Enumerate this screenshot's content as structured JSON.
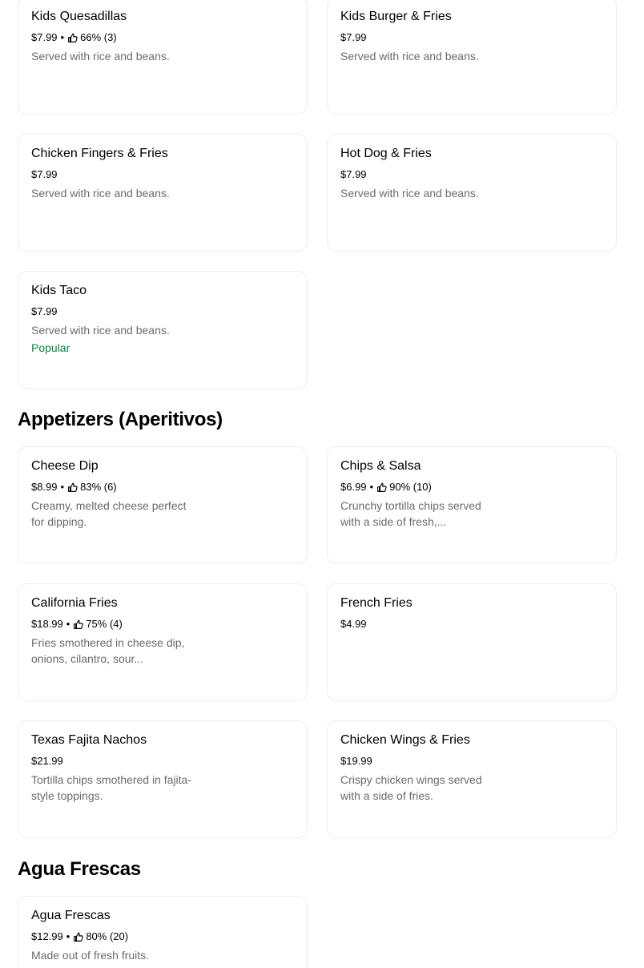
{
  "sections": [
    {
      "title": "",
      "items": [
        {
          "name": "Kids Quesadillas",
          "price": "$7.99",
          "rating": "66% (3)",
          "description": "Served with rice and beans.",
          "badge": ""
        },
        {
          "name": "Kids Burger & Fries",
          "price": "$7.99",
          "rating": "",
          "description": "Served with rice and beans.",
          "badge": ""
        },
        {
          "name": "Chicken Fingers & Fries",
          "price": "$7.99",
          "rating": "",
          "description": "Served with rice and beans.",
          "badge": ""
        },
        {
          "name": "Hot Dog & Fries",
          "price": "$7.99",
          "rating": "",
          "description": "Served with rice and beans.",
          "badge": ""
        },
        {
          "name": "Kids Taco",
          "price": "$7.99",
          "rating": "",
          "description": "Served with rice and beans.",
          "badge": "Popular"
        }
      ]
    },
    {
      "title": "Appetizers (Aperitivos)",
      "items": [
        {
          "name": "Cheese Dip",
          "price": "$8.99",
          "rating": "83% (6)",
          "description": "Creamy, melted cheese perfect for dipping.",
          "badge": ""
        },
        {
          "name": "Chips & Salsa",
          "price": "$6.99",
          "rating": "90% (10)",
          "description": "Crunchy tortilla chips served with a side of fresh,...",
          "badge": ""
        },
        {
          "name": "California Fries",
          "price": "$18.99",
          "rating": "75% (4)",
          "description": "Fries smothered in cheese dip, onions, cilantro, sour...",
          "badge": ""
        },
        {
          "name": "French Fries",
          "price": "$4.99",
          "rating": "",
          "description": "",
          "badge": ""
        },
        {
          "name": "Texas Fajita Nachos",
          "price": "$21.99",
          "rating": "",
          "description": "Tortilla chips smothered in fajita-style toppings.",
          "badge": ""
        },
        {
          "name": "Chicken Wings & Fries",
          "price": "$19.99",
          "rating": "",
          "description": "Crispy chicken wings served with a side of fries.",
          "badge": ""
        }
      ]
    },
    {
      "title": "Agua Frescas",
      "items": [
        {
          "name": "Agua Frescas",
          "price": "$12.99",
          "rating": "80% (20)",
          "description": "Made out of fresh fruits.",
          "badge": ""
        }
      ]
    }
  ],
  "icons": {
    "rating": "thumbs-up-icon"
  },
  "colors": {
    "popular": "#0e8345",
    "description": "#6b6b6b",
    "card_border": "#eeeeee"
  },
  "separator": "•"
}
